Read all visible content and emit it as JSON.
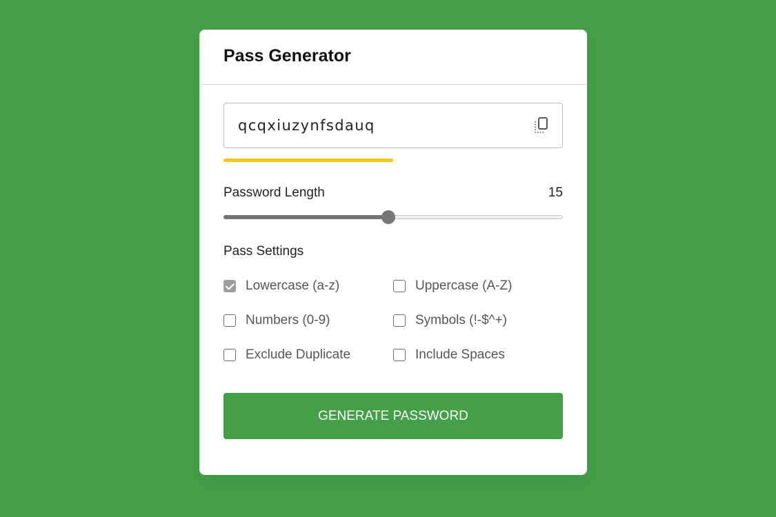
{
  "app": {
    "title": "Pass Generator",
    "background_color": "#43a047"
  },
  "password": {
    "value": "qcqxiuzynfsdauq",
    "copy_icon": "copy-icon"
  },
  "strength": {
    "level": 0.5,
    "color": "#f5c518"
  },
  "length": {
    "label": "Password Length",
    "value": "15",
    "slider_fraction": 0.485
  },
  "settings": {
    "title": "Pass Settings",
    "options": [
      {
        "label": "Lowercase (a-z)",
        "checked": true
      },
      {
        "label": "Uppercase (A-Z)",
        "checked": false
      },
      {
        "label": "Numbers (0-9)",
        "checked": false
      },
      {
        "label": "Symbols (!-$^+)",
        "checked": false
      },
      {
        "label": "Exclude Duplicate",
        "checked": false
      },
      {
        "label": "Include Spaces",
        "checked": false
      }
    ]
  },
  "generate_button": {
    "label": "GENERATE PASSWORD",
    "color": "#43a047"
  }
}
